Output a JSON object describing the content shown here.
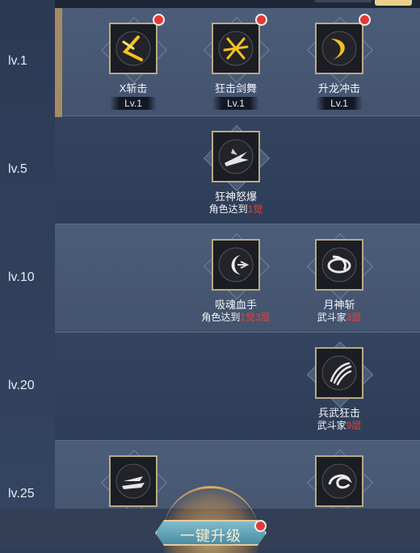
{
  "levels": [
    "lv.1",
    "lv.5",
    "lv.10",
    "lv.20",
    "lv.25"
  ],
  "skills": {
    "x_slash": {
      "name": "X斩击",
      "level": "Lv.1"
    },
    "frenzy_dance": {
      "name": "狂击剑舞",
      "level": "Lv.1"
    },
    "rising_dragon": {
      "name": "升龙冲击",
      "level": "Lv.1"
    },
    "wrath_burst": {
      "name": "狂神怒爆",
      "req_prefix": "角色达到",
      "req_value": "1觉",
      "req_suffix": ""
    },
    "soul_hand": {
      "name": "吸魂血手",
      "req_prefix": "角色达到",
      "req_value": "1觉3层",
      "req_suffix": ""
    },
    "moon_slash": {
      "name": "月神斩",
      "req_prefix": "武斗家",
      "req_value": "3层",
      "req_suffix": ""
    },
    "weapon_strike": {
      "name": "兵武狂击",
      "req_prefix": "武斗家",
      "req_value": "9层",
      "req_suffix": ""
    }
  },
  "upgrade_button": {
    "label": "一键升级"
  },
  "colors": {
    "requirement_highlight": "#e8433c",
    "badge": "#e23b34",
    "frame_gold": "#b8aa86"
  },
  "icons": [
    "x-slash-icon",
    "frenzy-dance-icon",
    "rising-dragon-icon",
    "wrath-burst-icon",
    "soul-hand-icon",
    "moon-slash-icon",
    "weapon-strike-icon",
    "wing-blade-icon",
    "vortex-icon"
  ]
}
